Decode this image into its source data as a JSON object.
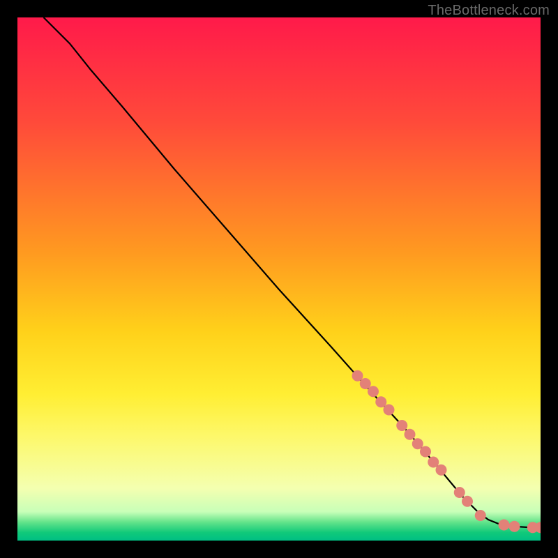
{
  "watermark": "TheBottleneck.com",
  "chart_data": {
    "type": "line",
    "title": "",
    "xlabel": "",
    "ylabel": "",
    "xlim": [
      0,
      100
    ],
    "ylim": [
      0,
      100
    ],
    "grid": false,
    "background_gradient": {
      "stops": [
        {
          "offset": 0.0,
          "color": "#ff1a4a"
        },
        {
          "offset": 0.2,
          "color": "#ff4a3a"
        },
        {
          "offset": 0.45,
          "color": "#ff9a20"
        },
        {
          "offset": 0.6,
          "color": "#ffd11a"
        },
        {
          "offset": 0.72,
          "color": "#ffee33"
        },
        {
          "offset": 0.8,
          "color": "#fdf86a"
        },
        {
          "offset": 0.9,
          "color": "#f4ffb0"
        },
        {
          "offset": 0.945,
          "color": "#c8ffb8"
        },
        {
          "offset": 0.965,
          "color": "#62e38a"
        },
        {
          "offset": 0.985,
          "color": "#10c97a"
        },
        {
          "offset": 1.0,
          "color": "#00bf83"
        }
      ]
    },
    "series": [
      {
        "name": "curve",
        "type": "line",
        "color": "#000000",
        "x": [
          5,
          7,
          10,
          14,
          20,
          30,
          40,
          50,
          60,
          68,
          74,
          80,
          85,
          88,
          90,
          92,
          95,
          98,
          100
        ],
        "y": [
          100,
          98,
          95,
          90,
          83,
          71,
          59.5,
          48,
          37,
          28,
          21.5,
          14.5,
          8.5,
          5.5,
          4,
          3.2,
          2.7,
          2.5,
          2.5
        ]
      },
      {
        "name": "highlight-dots",
        "type": "scatter",
        "color": "#e38178",
        "radius": 8,
        "points": [
          {
            "x": 65.0,
            "y": 31.5
          },
          {
            "x": 66.5,
            "y": 30.0
          },
          {
            "x": 68.0,
            "y": 28.5
          },
          {
            "x": 69.5,
            "y": 26.5
          },
          {
            "x": 71.0,
            "y": 25.0
          },
          {
            "x": 73.5,
            "y": 22.0
          },
          {
            "x": 75.0,
            "y": 20.3
          },
          {
            "x": 76.5,
            "y": 18.5
          },
          {
            "x": 78.0,
            "y": 17.0
          },
          {
            "x": 79.5,
            "y": 15.0
          },
          {
            "x": 81.0,
            "y": 13.5
          },
          {
            "x": 84.5,
            "y": 9.2
          },
          {
            "x": 86.0,
            "y": 7.5
          },
          {
            "x": 88.5,
            "y": 4.8
          },
          {
            "x": 93.0,
            "y": 3.0
          },
          {
            "x": 95.0,
            "y": 2.7
          },
          {
            "x": 98.5,
            "y": 2.5
          },
          {
            "x": 100.0,
            "y": 2.5
          }
        ]
      }
    ]
  }
}
